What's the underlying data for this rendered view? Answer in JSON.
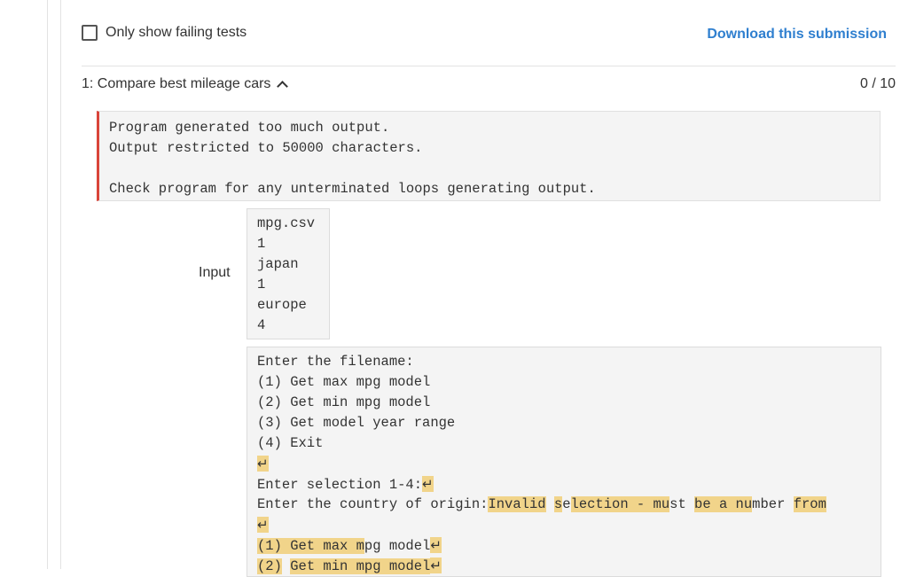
{
  "filters": {
    "only_failing_label": "Only show failing tests",
    "only_failing_checked": false
  },
  "download_label": "Download this submission",
  "test": {
    "title": "1: Compare best mileage cars",
    "score": "0 / 10"
  },
  "error_lines": [
    "Program generated too much output.",
    "Output restricted to 50000 characters.",
    "",
    "Check program for any unterminated loops generating output."
  ],
  "input_label": "Input",
  "input_lines": [
    "mpg.csv",
    "1",
    "japan",
    "1",
    "europe",
    "4"
  ],
  "newline_symbol": "↵",
  "output": {
    "l1": "Enter the filename:",
    "l2": "(1) Get max mpg model",
    "l3": "(2) Get min mpg model",
    "l4": "(3) Get model year range",
    "l5": "(4) Exit",
    "l7": "Enter selection 1-4:",
    "l8_plain": "Enter the country of origin:",
    "l8_a": "Invalid",
    "l8_b": " ",
    "l8_c": "s",
    "l8_d": "e",
    "l8_e": "lection - mu",
    "l8_f": "st ",
    "l8_g": "be a nu",
    "l8_h": "mber ",
    "l8_i": "from",
    "l10_a": "(1) Get max m",
    "l10_b": "pg model",
    "l11_a": "(2)",
    "l11_b": " ",
    "l11_c": "Get min mpg model"
  }
}
